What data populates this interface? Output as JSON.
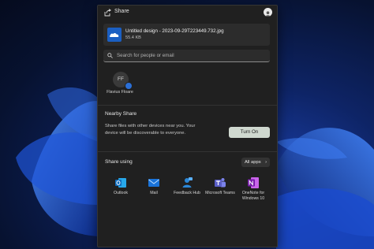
{
  "dialog": {
    "title": "Share"
  },
  "file": {
    "name": "Untitled design - 2023-09-29T223449.732.jpg",
    "size": "55.4 KB"
  },
  "search": {
    "placeholder": "Search for people or email"
  },
  "contact": {
    "initials": "FF",
    "name": "Flavius Floare"
  },
  "nearby": {
    "title": "Nearby Share",
    "description": "Share files with other devices near you. Your device will be discoverable to everyone.",
    "button": "Turn On"
  },
  "share_using": {
    "title": "Share using",
    "all_apps": "All apps",
    "apps": [
      {
        "label": "Outlook",
        "icon": "outlook-icon",
        "color": "#0f6cbd"
      },
      {
        "label": "Mail",
        "icon": "mail-icon",
        "color": "#1a73d9"
      },
      {
        "label": "Feedback Hub",
        "icon": "feedback-hub-icon",
        "color": "#2b88d8"
      },
      {
        "label": "Microsoft Teams",
        "icon": "teams-icon",
        "color": "#5b5fc7"
      },
      {
        "label": "OneNote for Windows 10",
        "icon": "onenote-icon",
        "color": "#7719aa"
      }
    ]
  },
  "colors": {
    "dialog_bg": "#202020",
    "accent_button": "#cfd8cf",
    "wallpaper": "#1b3fa8"
  }
}
